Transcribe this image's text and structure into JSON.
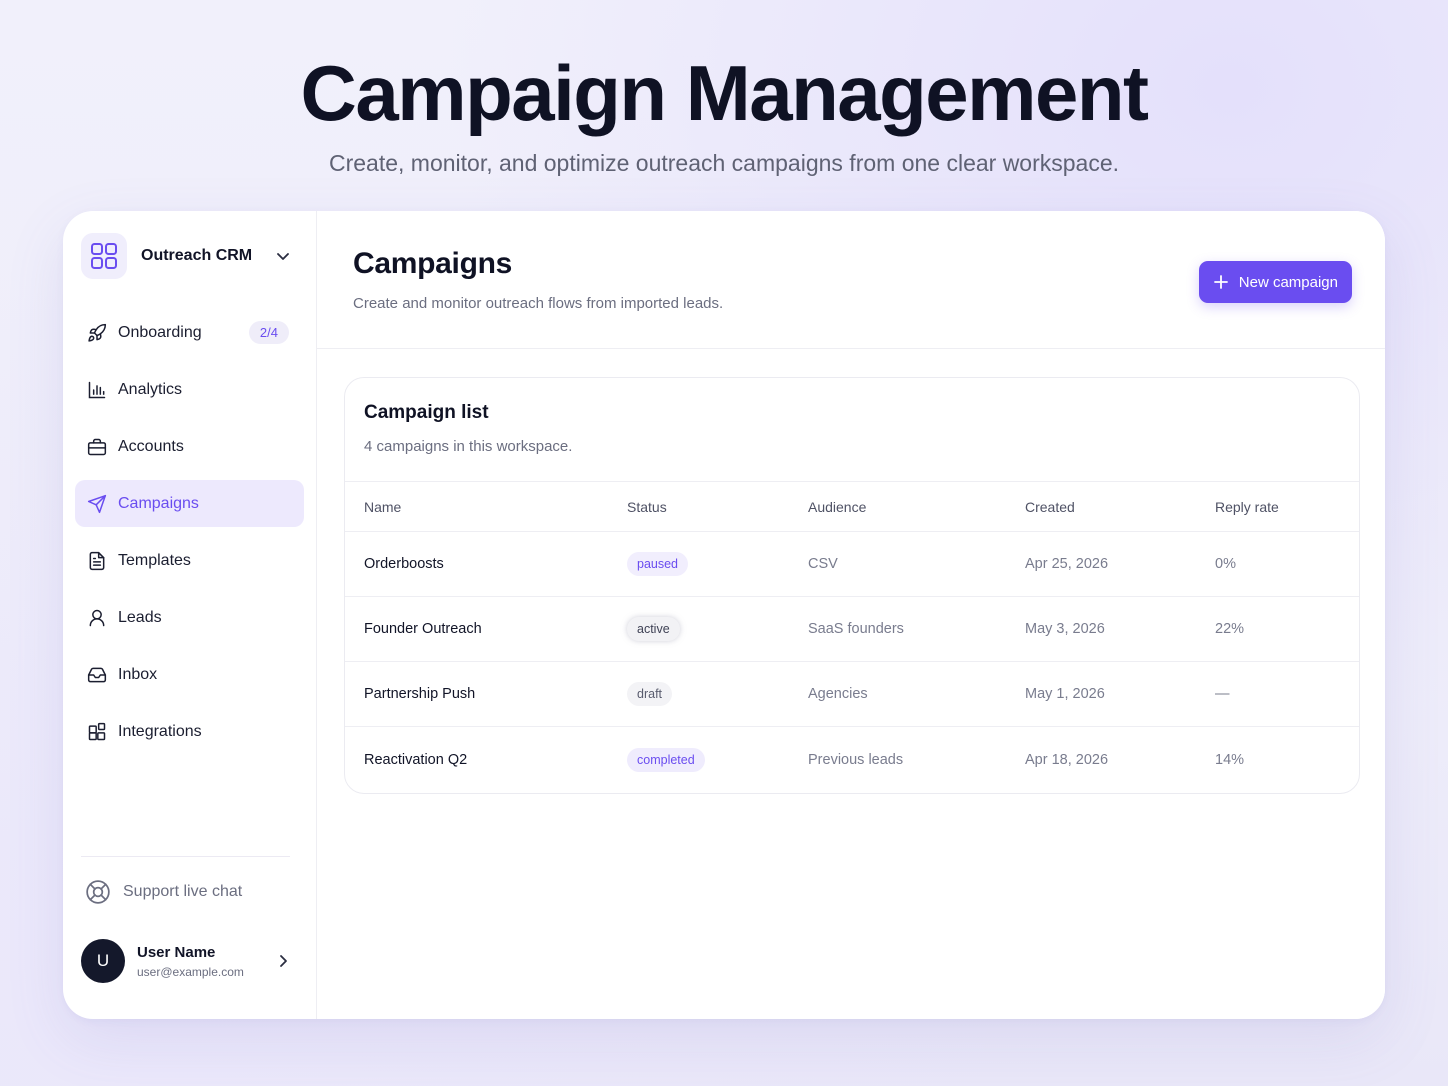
{
  "hero": {
    "title": "Campaign Management",
    "subtitle": "Create, monitor, and optimize outreach campaigns from one clear workspace."
  },
  "sidebar": {
    "workspace": {
      "name": "Outreach CRM",
      "logo_icon": "grid-icon",
      "chevron_icon": "chevron-down-icon"
    },
    "items": [
      {
        "label": "Onboarding",
        "icon": "rocket-icon",
        "badge": "2/4"
      },
      {
        "label": "Analytics",
        "icon": "bar-chart-icon"
      },
      {
        "label": "Accounts",
        "icon": "briefcase-icon"
      },
      {
        "label": "Campaigns",
        "icon": "send-icon",
        "active": true
      },
      {
        "label": "Templates",
        "icon": "document-icon"
      },
      {
        "label": "Leads",
        "icon": "user-icon"
      },
      {
        "label": "Inbox",
        "icon": "inbox-icon"
      },
      {
        "label": "Integrations",
        "icon": "apps-icon"
      }
    ],
    "support": {
      "label": "Support live chat",
      "icon": "lifebuoy-icon"
    },
    "user": {
      "initial": "U",
      "name": "User Name",
      "email": "user@example.com"
    }
  },
  "main": {
    "title": "Campaigns",
    "subtitle": "Create and monitor outreach flows from imported leads.",
    "new_button": "New campaign",
    "card": {
      "title": "Campaign list",
      "subtitle": "4 campaigns in this workspace.",
      "columns": [
        "Name",
        "Status",
        "Audience",
        "Created",
        "Reply rate"
      ],
      "rows": [
        {
          "name": "Orderboosts",
          "status": "paused",
          "audience": "CSV",
          "created": "Apr 25, 2026",
          "reply_rate": "0%"
        },
        {
          "name": "Founder Outreach",
          "status": "active",
          "audience": "SaaS founders",
          "created": "May 3, 2026",
          "reply_rate": "22%"
        },
        {
          "name": "Partnership Push",
          "status": "draft",
          "audience": "Agencies",
          "created": "May 1, 2026",
          "reply_rate": "—"
        },
        {
          "name": "Reactivation Q2",
          "status": "completed",
          "audience": "Previous leads",
          "created": "Apr 18, 2026",
          "reply_rate": "14%"
        }
      ]
    }
  },
  "colors": {
    "accent": "#6a4df0",
    "accent_soft": "#ede9fd",
    "text_dark": "#0f1224",
    "text_muted": "#6b6e80"
  }
}
